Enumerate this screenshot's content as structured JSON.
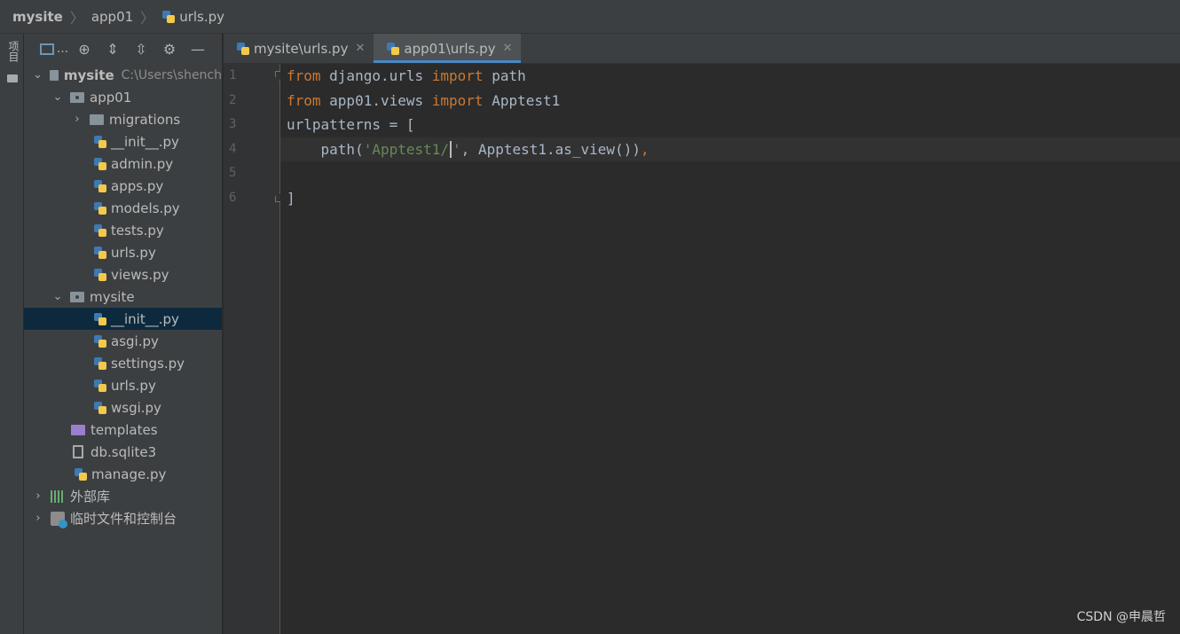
{
  "breadcrumb": {
    "items": [
      "mysite",
      "app01",
      "urls.py"
    ]
  },
  "toolstrip": {
    "project_label": "项目"
  },
  "project_panel": {
    "toolbar": {
      "layout_icon": "layout-icon",
      "ellipsis": "..."
    },
    "root": {
      "name": "mysite",
      "path": "C:\\Users\\shench"
    },
    "app01": {
      "name": "app01",
      "children": [
        "migrations",
        "__init__.py",
        "admin.py",
        "apps.py",
        "models.py",
        "tests.py",
        "urls.py",
        "views.py"
      ]
    },
    "mysite_pkg": {
      "name": "mysite",
      "children": [
        "__init__.py",
        "asgi.py",
        "settings.py",
        "urls.py",
        "wsgi.py"
      ]
    },
    "templates": "templates",
    "db": "db.sqlite3",
    "manage": "manage.py",
    "external_libs": "外部库",
    "scratches": "临时文件和控制台"
  },
  "tabs": [
    {
      "label": "mysite\\urls.py",
      "active": false
    },
    {
      "label": "app01\\urls.py",
      "active": true
    }
  ],
  "editor": {
    "line_numbers": [
      "1",
      "2",
      "3",
      "4",
      "5",
      "6"
    ],
    "current_line": 4,
    "code": {
      "l1": {
        "kw1": "from",
        "mod": " django.urls ",
        "kw2": "import",
        "name": " path"
      },
      "l2": {
        "kw1": "from",
        "mod": " app01.views ",
        "kw2": "import",
        "name": " Apptest1"
      },
      "l3": {
        "text": "urlpatterns = ["
      },
      "l4": {
        "indent": "    path(",
        "str_a": "'Apptest1/",
        "str_b": "'",
        "rest": ", Apptest1.as_view())",
        "comma": ","
      },
      "l5": {
        "text": ""
      },
      "l6": {
        "text": "]"
      }
    }
  },
  "watermark": "CSDN @申晨哲",
  "colors": {
    "keyword": "#cc7832",
    "string": "#6a8759",
    "selection": "#0d293e",
    "tab_accent": "#4a88c7"
  }
}
